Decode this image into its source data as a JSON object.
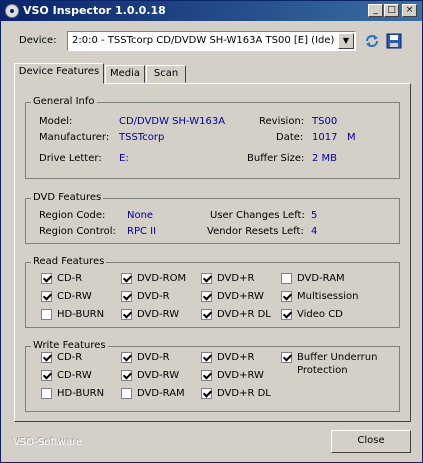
{
  "window": {
    "title": "VSO Inspector 1.0.0.18"
  },
  "device": {
    "label": "Device:",
    "selected": "2:0:0 - TSSTcorp CD/DVDW SH-W163A TS00 [E] (Ide)"
  },
  "tabs": [
    {
      "label": "Device Features",
      "active": true
    },
    {
      "label": "Media",
      "active": false
    },
    {
      "label": "Scan",
      "active": false
    }
  ],
  "general": {
    "title": "General Info",
    "model_label": "Model:",
    "model": "CD/DVDW SH-W163A",
    "manufacturer_label": "Manufacturer:",
    "manufacturer": "TSSTcorp",
    "drive_letter_label": "Drive Letter:",
    "drive_letter": "E:",
    "revision_label": "Revision:",
    "revision": "TS00",
    "date_label": "Date:",
    "date": "1017   M",
    "buffer_label": "Buffer Size:",
    "buffer": "2 MB"
  },
  "dvd": {
    "title": "DVD Features",
    "region_code_label": "Region Code:",
    "region_code": "None",
    "region_control_label": "Region Control:",
    "region_control": "RPC II",
    "user_changes_label": "User Changes Left:",
    "user_changes": "5",
    "vendor_resets_label": "Vendor Resets Left:",
    "vendor_resets": "4"
  },
  "read": {
    "title": "Read Features",
    "items": [
      {
        "label": "CD-R",
        "checked": true
      },
      {
        "label": "CD-RW",
        "checked": true
      },
      {
        "label": "HD-BURN",
        "checked": false
      },
      {
        "label": "DVD-ROM",
        "checked": true
      },
      {
        "label": "DVD-R",
        "checked": true
      },
      {
        "label": "DVD-RW",
        "checked": true
      },
      {
        "label": "DVD+R",
        "checked": true
      },
      {
        "label": "DVD+RW",
        "checked": true
      },
      {
        "label": "DVD+R DL",
        "checked": true
      },
      {
        "label": "DVD-RAM",
        "checked": false
      },
      {
        "label": "Multisession",
        "checked": true
      },
      {
        "label": "Video CD",
        "checked": true
      }
    ]
  },
  "write": {
    "title": "Write Features",
    "items": [
      {
        "label": "CD-R",
        "checked": true
      },
      {
        "label": "CD-RW",
        "checked": true
      },
      {
        "label": "HD-BURN",
        "checked": false
      },
      {
        "label": "DVD-R",
        "checked": true
      },
      {
        "label": "DVD-RW",
        "checked": true
      },
      {
        "label": "DVD-RAM",
        "checked": false
      },
      {
        "label": "DVD+R",
        "checked": true
      },
      {
        "label": "DVD+RW",
        "checked": true
      },
      {
        "label": "DVD+R DL",
        "checked": true
      },
      {
        "label": "Buffer Underrun",
        "label2": "Protection",
        "checked": true
      }
    ]
  },
  "footer": {
    "brand": "VSO-Software",
    "close_label": "Close"
  },
  "colors": {
    "titlebar": "#0a246a",
    "value_text": "#0000a0",
    "face": "#d4d0c8"
  },
  "icons": {
    "refresh": "refresh-icon",
    "save": "save-icon"
  }
}
